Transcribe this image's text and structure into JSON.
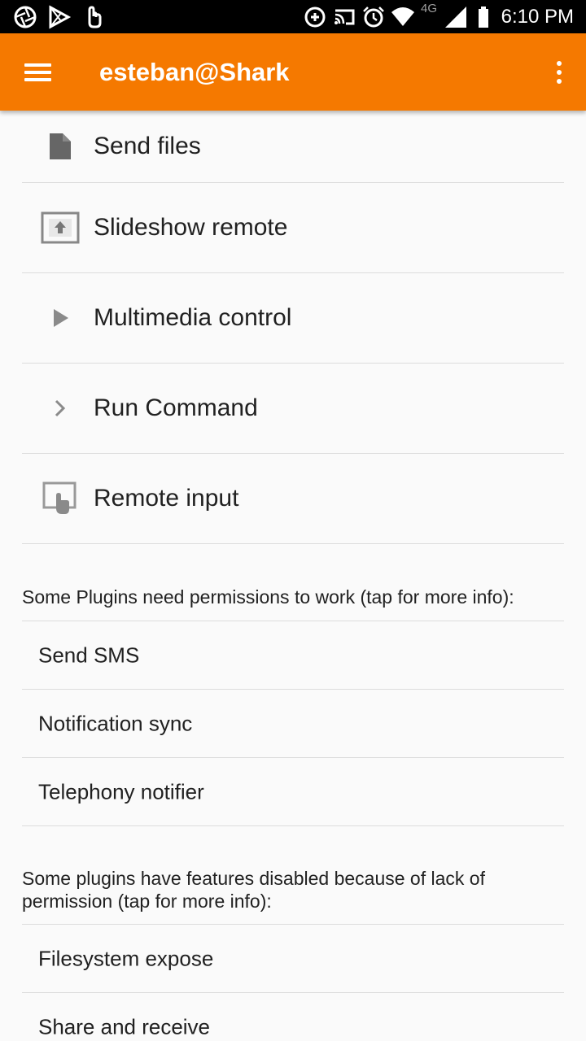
{
  "status_bar": {
    "time": "6:10 PM",
    "network": "4G",
    "icons": [
      "aperture-icon",
      "play-store-icon",
      "touch-icon",
      "data-saver-icon",
      "cast-icon",
      "alarm-icon",
      "wifi-icon",
      "signal-icon",
      "battery-icon"
    ]
  },
  "app_bar": {
    "title": "esteban@Shark",
    "menu_icon": "hamburger-menu-icon",
    "overflow_icon": "more-vert-icon"
  },
  "plugins": [
    {
      "label": "Send files",
      "icon": "file-icon"
    },
    {
      "label": "Slideshow remote",
      "icon": "slideshow-icon"
    },
    {
      "label": "Multimedia control",
      "icon": "play-icon"
    },
    {
      "label": "Run Command",
      "icon": "chevron-right-icon"
    },
    {
      "label": "Remote input",
      "icon": "touchpad-icon"
    }
  ],
  "permissions_section": {
    "header": "Some Plugins need permissions to work (tap for more info):",
    "items": [
      "Send SMS",
      "Notification sync",
      "Telephony notifier"
    ]
  },
  "disabled_section": {
    "header": "Some plugins have features disabled because of lack of permission (tap for more info):",
    "items": [
      "Filesystem expose",
      "Share and receive"
    ]
  },
  "colors": {
    "accent": "#f57900",
    "background": "#fafafa",
    "divider": "#dcdcdc",
    "icon_gray": "#757575"
  }
}
